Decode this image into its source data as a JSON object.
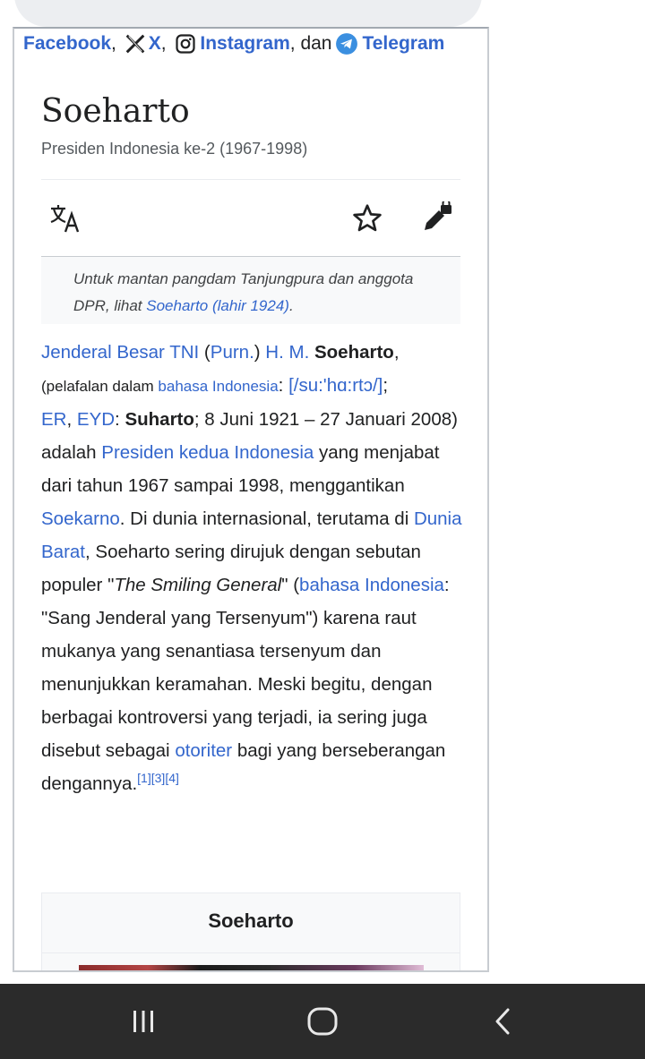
{
  "social": {
    "facebook": "Facebook",
    "x": "X",
    "instagram": "Instagram",
    "dan": "dan",
    "telegram": "Telegram",
    "icons": [
      "x-logo-icon",
      "instagram-icon",
      "telegram-icon"
    ]
  },
  "article": {
    "title": "Soeharto",
    "subtitle": "Presiden Indonesia ke-2 (1967-1998)"
  },
  "actions": {
    "icons": [
      "language-icon",
      "star-icon",
      "edit-lock-icon"
    ]
  },
  "hatnote": {
    "text": "Untuk mantan pangdam Tanjungpura dan anggota DPR, lihat ",
    "link": "Soeharto (lahir 1924)",
    "end": "."
  },
  "paragraph": {
    "l1": "Jenderal Besar TNI",
    "t1": " (",
    "l2": "Purn.",
    "t2": ") ",
    "l3": "H. M.",
    "b1": "Soeharto",
    "t3": ",",
    "s1": "(pelafalan dalam ",
    "l4": "bahasa Indonesia",
    "t4": ": ",
    "l5": "[/su:'hɑ:rtɔ/]",
    "t5": ";",
    "l6": "ER",
    "t6": ", ",
    "l7": "EYD",
    "t7": ": ",
    "b2": "Suharto",
    "t8": "; 8 Juni 1921 – 27 Januari 2008) adalah ",
    "l8": "Presiden kedua Indonesia",
    "t9": " yang menjabat dari tahun 1967 sampai 1998, menggantikan ",
    "l9": "Soekarno",
    "t10": ". Di dunia internasional, terutama di ",
    "l10": "Dunia Barat",
    "t11": ", Soeharto sering dirujuk dengan sebutan populer \"",
    "i1": "The Smiling General",
    "t12": "\" (",
    "l11": "bahasa Indonesia",
    "t13": ": \"Sang Jenderal yang Tersenyum\") karena raut mukanya yang senantiasa tersenyum dan menunjukkan keramahan. Meski begitu, dengan berbagai kontroversi yang terjadi, ia sering juga disebut sebagai ",
    "l12": "otoriter",
    "t14": " bagi yang berseberangan dengannya.",
    "ref1": "[1]",
    "ref2": "[3]",
    "ref3": "[4]"
  },
  "infobox": {
    "title": "Soeharto"
  },
  "navbar": {
    "icons": [
      "recent-apps-icon",
      "home-icon",
      "back-icon"
    ]
  },
  "colors": {
    "link": "#3366cc",
    "text": "#202122",
    "navbar": "#2b2b2b"
  }
}
